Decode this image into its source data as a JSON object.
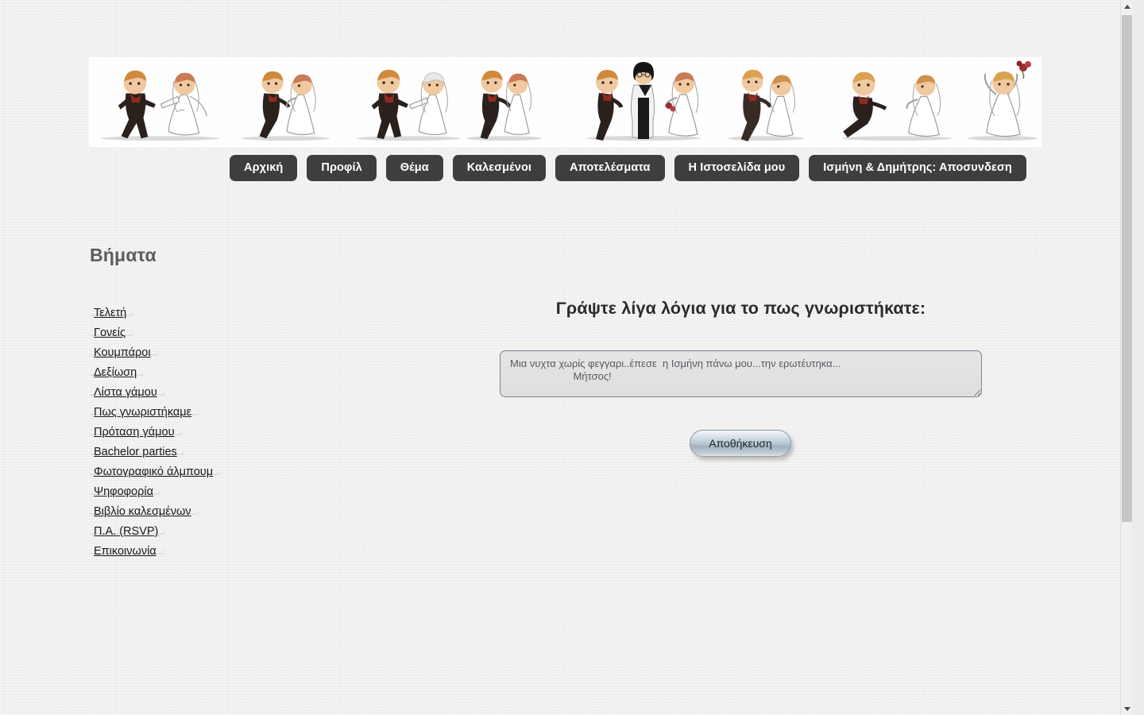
{
  "banner": {
    "alt": "wedding-couples-cartoon-banner",
    "figure_count": 8
  },
  "nav": {
    "items": [
      {
        "label": "Αρχική",
        "name": "nav-home"
      },
      {
        "label": "Προφίλ",
        "name": "nav-profile"
      },
      {
        "label": "Θέμα",
        "name": "nav-theme"
      },
      {
        "label": "Καλεσμένοι",
        "name": "nav-guests"
      },
      {
        "label": "Αποτελέσματα",
        "name": "nav-results"
      },
      {
        "label": "Η Ιστοσελίδα μου",
        "name": "nav-my-website"
      },
      {
        "label": "Ισμήνη & Δημήτρης: Αποσυνδεση",
        "name": "nav-logout"
      }
    ]
  },
  "sidebar": {
    "title": "Βήματα",
    "items": [
      {
        "label": "Τελετή",
        "name": "sidebar-link-ceremony"
      },
      {
        "label": "Γονείς",
        "name": "sidebar-link-parents"
      },
      {
        "label": "Κουμπάροι",
        "name": "sidebar-link-best-men"
      },
      {
        "label": "Δεξίωση",
        "name": "sidebar-link-reception"
      },
      {
        "label": "Λίστα γάμου",
        "name": "sidebar-link-wedding-list"
      },
      {
        "label": "Πως γνωριστήκαμε",
        "name": "sidebar-link-how-we-met"
      },
      {
        "label": "Πρόταση γάμου",
        "name": "sidebar-link-proposal"
      },
      {
        "label": "Bachelor parties",
        "name": "sidebar-link-bachelor-parties"
      },
      {
        "label": "Φωτογραφικό άλμπουμ",
        "name": "sidebar-link-photo-album"
      },
      {
        "label": "Ψηφοφορία",
        "name": "sidebar-link-poll"
      },
      {
        "label": "Βιβλίο καλεσμένων",
        "name": "sidebar-link-guestbook"
      },
      {
        "label": "Π.Α. (RSVP)",
        "name": "sidebar-link-rsvp"
      },
      {
        "label": "Επικοινωνία",
        "name": "sidebar-link-contact"
      }
    ]
  },
  "main": {
    "heading": "Γράψτε λίγα λόγια για το πως γνωριστήκατε:",
    "story": {
      "value": "Μια νυχτα χωρίς φεγγαρι..έπεσε  η Ισμήνη πάνω μου...την ερωτέυτηκα...\n                      Μήτσος!",
      "placeholder": "Μια νυχτα χωρίς φεγγαρι..έπεσε  η Ισμήνη πάνω μου...την ερωτέυτηκα..."
    },
    "save_label": "Αποθήκευση"
  },
  "colors": {
    "page_background": "#ededec",
    "nav_button": "#3e3e3e",
    "nav_button_text": "#ffffff",
    "sidebar_title": "#5d5d5d",
    "heading": "#2a2a2a",
    "textarea_border": "#7d8a99",
    "textarea_background": "#e3e3e3",
    "save_button_accent": "#b7c6d2",
    "scrollbar_thumb": "#c6c6c6"
  },
  "scrollbar": {
    "up_icon": "chevron-up-icon",
    "down_icon": "chevron-down-icon"
  }
}
